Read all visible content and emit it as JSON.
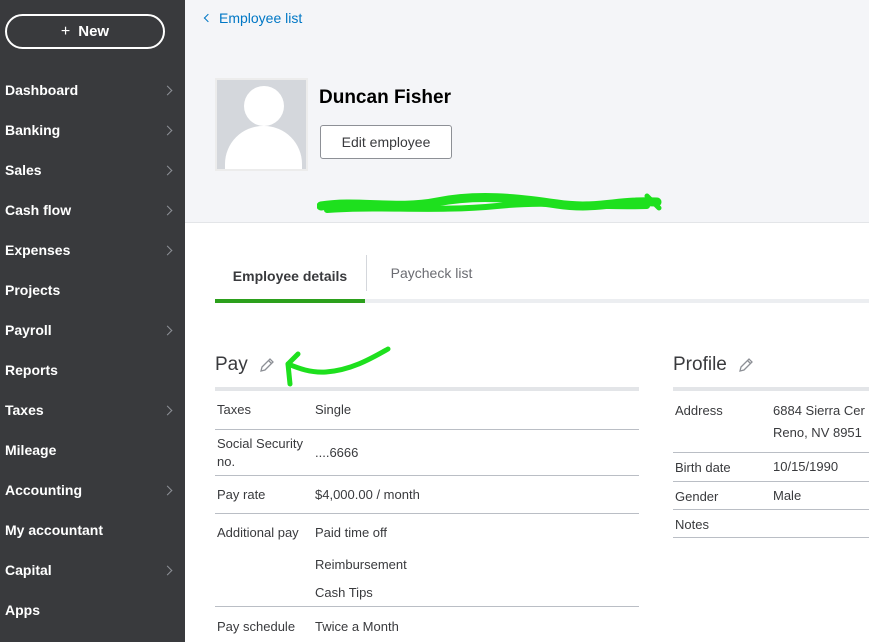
{
  "sidebar": {
    "new_label": "New",
    "new_icon": "plus-icon",
    "items": [
      {
        "label": "Dashboard",
        "chevron": true
      },
      {
        "label": "Banking",
        "chevron": true
      },
      {
        "label": "Sales",
        "chevron": true
      },
      {
        "label": "Cash flow",
        "chevron": true
      },
      {
        "label": "Expenses",
        "chevron": true
      },
      {
        "label": "Projects",
        "chevron": false
      },
      {
        "label": "Payroll",
        "chevron": true
      },
      {
        "label": "Reports",
        "chevron": false
      },
      {
        "label": "Taxes",
        "chevron": true
      },
      {
        "label": "Mileage",
        "chevron": false
      },
      {
        "label": "Accounting",
        "chevron": true
      },
      {
        "label": "My accountant",
        "chevron": false
      },
      {
        "label": "Capital",
        "chevron": true
      },
      {
        "label": "Apps",
        "chevron": false
      }
    ]
  },
  "header": {
    "back_label": "Employee list",
    "employee_name": "Duncan Fisher",
    "edit_label": "Edit employee"
  },
  "tabs": [
    {
      "label": "Employee details",
      "active": true
    },
    {
      "label": "Paycheck list",
      "active": false
    }
  ],
  "pay": {
    "title": "Pay",
    "rows": {
      "taxes": {
        "label": "Taxes",
        "value": "Single"
      },
      "ssn": {
        "label1": "Social Security",
        "label2": "no.",
        "value": "....6666"
      },
      "pay_rate": {
        "label": "Pay rate",
        "value": "$4,000.00 / month"
      },
      "additional": {
        "label": "Additional pay",
        "values": [
          "Paid time off",
          "Reimbursement",
          "Cash Tips"
        ]
      },
      "schedule": {
        "label": "Pay schedule",
        "value": "Twice a Month"
      }
    }
  },
  "profile": {
    "title": "Profile",
    "rows": {
      "address": {
        "label": "Address",
        "line1": "6884 Sierra Cer",
        "line2": "Reno, NV 8951"
      },
      "birth": {
        "label": "Birth date",
        "value": "10/15/1990"
      },
      "gender": {
        "label": "Gender",
        "value": "Male"
      },
      "notes": {
        "label": "Notes",
        "value": ""
      }
    }
  },
  "colors": {
    "sidebar_bg": "#393a3d",
    "accent_green": "#2ca01c",
    "link_blue": "#0077c5",
    "annotation_green": "#1ee01e"
  }
}
